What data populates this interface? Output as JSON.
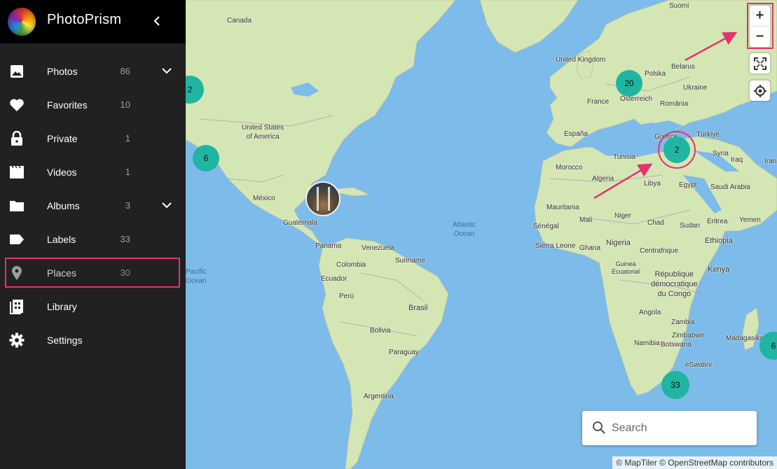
{
  "app": {
    "title": "PhotoPrism"
  },
  "sidebar": {
    "items": [
      {
        "label": "Photos",
        "count": "86",
        "icon": "image-icon",
        "expandable": true
      },
      {
        "label": "Favorites",
        "count": "10",
        "icon": "heart-icon",
        "expandable": false
      },
      {
        "label": "Private",
        "count": "1",
        "icon": "lock-icon",
        "expandable": false
      },
      {
        "label": "Videos",
        "count": "1",
        "icon": "movie-icon",
        "expandable": false
      },
      {
        "label": "Albums",
        "count": "3",
        "icon": "folder-icon",
        "expandable": true
      },
      {
        "label": "Labels",
        "count": "33",
        "icon": "label-icon",
        "expandable": false
      },
      {
        "label": "Places",
        "count": "30",
        "icon": "place-icon",
        "expandable": false,
        "active": true
      },
      {
        "label": "Library",
        "count": "",
        "icon": "library-icon",
        "expandable": false
      },
      {
        "label": "Settings",
        "count": "",
        "icon": "gear-icon",
        "expandable": false
      }
    ]
  },
  "map": {
    "clusters": [
      "2",
      "6",
      "20",
      "2",
      "33",
      "6"
    ],
    "labels": {
      "canada": "Canada",
      "usa": "United States\nof America",
      "mexico": "México",
      "guatemala": "Guatemala",
      "panama": "Panama",
      "venezuela": "Venezuela",
      "suriname": "Suriname",
      "colombia": "Colombia",
      "ecuador": "Ecuador",
      "peru": "Perú",
      "brasil": "Brasil",
      "bolivia": "Bolivia",
      "paraguay": "Paraguay",
      "argentina": "Argentina",
      "atlantic": "Atlantic\nOcean",
      "pacific": "Pacific\nOcean",
      "uk": "United Kingdom",
      "polska": "Polska",
      "belarus": "Belarus",
      "ukraine": "Ukraine",
      "france": "France",
      "osterreich": "Österreich",
      "romania": "România",
      "espana": "España",
      "greece": "Greece",
      "turkiye": "Türkiye",
      "suomi": "Suomi",
      "tunisia": "Tunisia",
      "syria": "Syria",
      "iraq": "Iraq",
      "morocco": "Morocco",
      "algeria": "Algeria",
      "libya": "Libya",
      "egypt": "Egypt",
      "saudi": "Saudi Arabia",
      "mauritania": "Mauritania",
      "mali": "Mali",
      "niger": "Niger",
      "chad": "Chad",
      "sudan": "Sudan",
      "eritrea": "Eritrea",
      "yemen": "Yemen",
      "senegal": "Sénégal",
      "sierra": "Sierra Leone",
      "ghana": "Ghana",
      "nigeria": "Nigeria",
      "ethiopia": "Ethiopia",
      "centrafrique": "Centrafrique",
      "guinea": "Guinea\nEcuatorial",
      "rdc": "République\ndémocratique\ndu Congo",
      "kenya": "Kenya",
      "angola": "Angola",
      "zambia": "Zambia",
      "zimbabwe": "Zimbabwe",
      "namibia": "Namibia",
      "botswana": "Botswana",
      "eswatini": "eSwatini",
      "madagascar": "Madagasikara",
      "iran": "Iran"
    },
    "search_placeholder": "Search",
    "attribution": "© MapTiler © OpenStreetMap contributors",
    "controls": {
      "zoom_in": "+",
      "zoom_out": "−"
    }
  },
  "colors": {
    "highlight": "#e0356d",
    "cluster": "#1fb5a1",
    "water": "#7dbbea",
    "land": "#d4e4b4"
  }
}
